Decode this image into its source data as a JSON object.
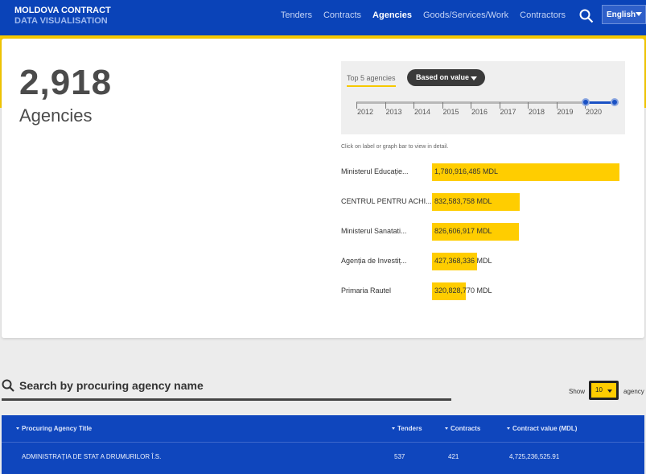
{
  "header": {
    "brand_line1": "MOLDOVA CONTRACT",
    "brand_line2": "DATA VISUALISATION",
    "nav": [
      {
        "label": "Tenders",
        "active": false
      },
      {
        "label": "Contracts",
        "active": false
      },
      {
        "label": "Agencies",
        "active": true
      },
      {
        "label": "Goods/Services/Work",
        "active": false
      },
      {
        "label": "Contractors",
        "active": false
      }
    ],
    "language": "English",
    "search_icon": "search-icon"
  },
  "summary": {
    "count": "2,918",
    "label": "Agencies"
  },
  "filters": {
    "tab_label": "Top 5 agencies",
    "sort_label": "Based on value",
    "years": [
      "2012",
      "2013",
      "2014",
      "2015",
      "2016",
      "2017",
      "2018",
      "2019",
      "2020"
    ],
    "selected_range": [
      "2020",
      "2020"
    ]
  },
  "hint": "Click on label or graph bar to view in detail.",
  "chart_data": {
    "type": "bar",
    "orientation": "horizontal",
    "categories": [
      "Ministerul Educație...",
      "CENTRUL PENTRU ACHI...",
      "Ministerul Sanatati...",
      "Agenția de Investiț...",
      "Primaria Rautel"
    ],
    "values": [
      1780916485,
      832583758,
      826606917,
      427368336,
      320828770
    ],
    "value_labels": [
      "1,780,916,485 MDL",
      "832,583,758 MDL",
      "826,606,917 MDL",
      "427,368,336 MDL",
      "320,828,770 MDL"
    ],
    "bar_color": "#ffcd00"
  },
  "search": {
    "title": "Search by procuring agency name",
    "show_label": "Show",
    "page_size": "10",
    "after_label": "agency"
  },
  "table": {
    "columns": [
      "Procuring Agency Title",
      "Tenders",
      "Contracts",
      "Contract value (MDL)"
    ],
    "rows": [
      {
        "title": "ADMINISTRAȚIA DE STAT A DRUMURILOR Î.S.",
        "tenders": "537",
        "contracts": "421",
        "value": "4,725,236,525.91"
      }
    ]
  },
  "colors": {
    "primary": "#0a43b8",
    "accent": "#ffcd00"
  }
}
